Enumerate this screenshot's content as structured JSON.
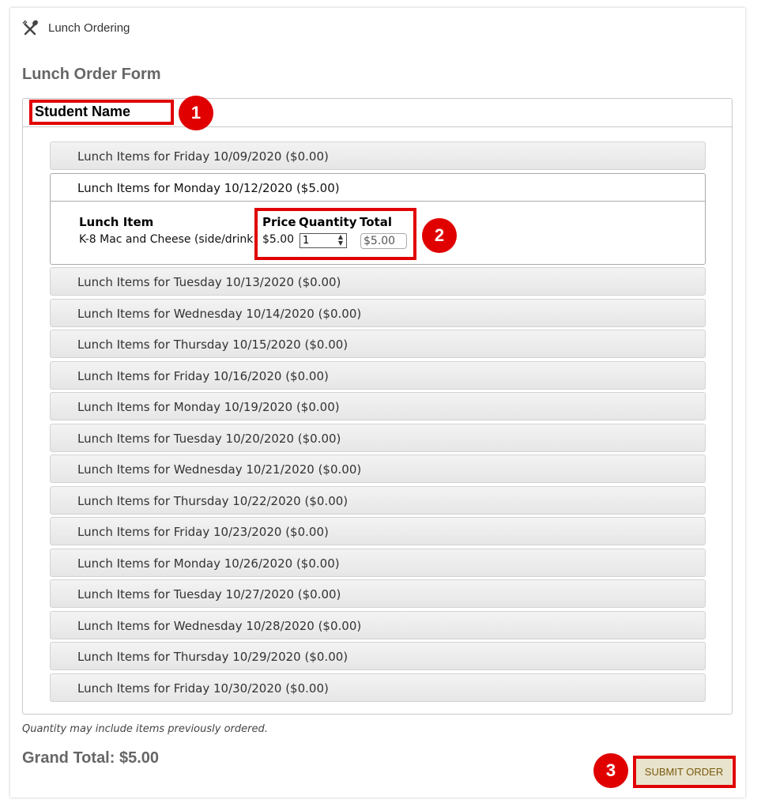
{
  "app": {
    "title": "Lunch Ordering",
    "icon": "utensils-icon"
  },
  "form": {
    "title": "Lunch Order Form",
    "student_label": "Student Name"
  },
  "days": [
    {
      "label": "Lunch Items for Friday 10/09/2020 ($0.00)",
      "expanded": false
    },
    {
      "label": "Lunch Items for Monday 10/12/2020 ($5.00)",
      "expanded": true
    },
    {
      "label": "Lunch Items for Tuesday 10/13/2020 ($0.00)",
      "expanded": false
    },
    {
      "label": "Lunch Items for Wednesday 10/14/2020 ($0.00)",
      "expanded": false
    },
    {
      "label": "Lunch Items for Thursday 10/15/2020 ($0.00)",
      "expanded": false
    },
    {
      "label": "Lunch Items for Friday 10/16/2020 ($0.00)",
      "expanded": false
    },
    {
      "label": "Lunch Items for Monday 10/19/2020 ($0.00)",
      "expanded": false
    },
    {
      "label": "Lunch Items for Tuesday 10/20/2020 ($0.00)",
      "expanded": false
    },
    {
      "label": "Lunch Items for Wednesday 10/21/2020 ($0.00)",
      "expanded": false
    },
    {
      "label": "Lunch Items for Thursday 10/22/2020 ($0.00)",
      "expanded": false
    },
    {
      "label": "Lunch Items for Friday 10/23/2020 ($0.00)",
      "expanded": false
    },
    {
      "label": "Lunch Items for Monday 10/26/2020 ($0.00)",
      "expanded": false
    },
    {
      "label": "Lunch Items for Tuesday 10/27/2020 ($0.00)",
      "expanded": false
    },
    {
      "label": "Lunch Items for Wednesday 10/28/2020 ($0.00)",
      "expanded": false
    },
    {
      "label": "Lunch Items for Thursday 10/29/2020 ($0.00)",
      "expanded": false
    },
    {
      "label": "Lunch Items for Friday 10/30/2020 ($0.00)",
      "expanded": false
    }
  ],
  "expanded_table": {
    "headers": {
      "item": "Lunch Item",
      "price": "Price",
      "quantity": "Quantity",
      "total": "Total"
    },
    "rows": [
      {
        "item": "K-8 Mac and Cheese (side/drink)",
        "item_display": "K-8 Mac and Cheese (side/drink",
        "price": "$5.00",
        "quantity": "1",
        "total": "$5.00"
      }
    ]
  },
  "note": "Quantity may include items previously ordered.",
  "grand_total": "Grand Total: $5.00",
  "submit_label": "SUBMIT ORDER",
  "callouts": [
    "1",
    "2",
    "3"
  ],
  "colors": {
    "callout": "#e00000",
    "submit_bg": "#e8e3cc",
    "submit_text": "#7a5a10",
    "title_gray": "#666666"
  }
}
